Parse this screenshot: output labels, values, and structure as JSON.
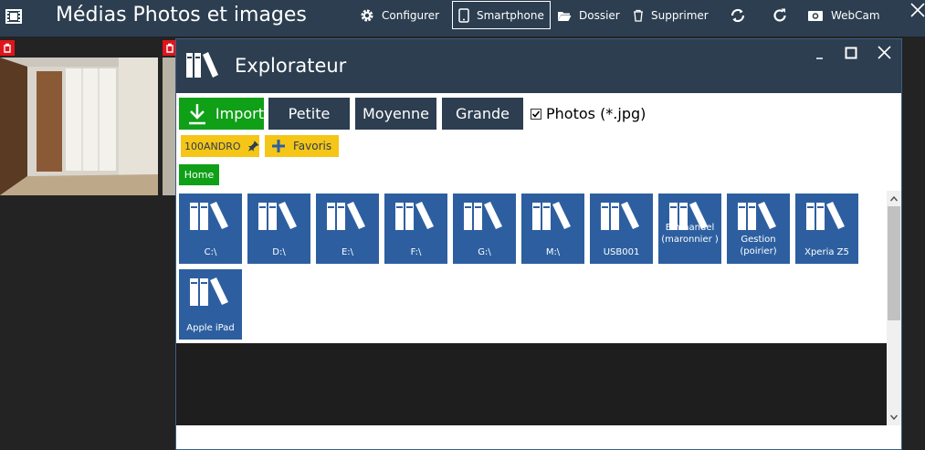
{
  "app": {
    "title": "Médias Photos et images"
  },
  "toolbar": {
    "configure": "Configurer",
    "smartphone": "Smartphone",
    "folder": "Dossier",
    "delete": "Supprimer",
    "webcam": "WebCam"
  },
  "explorer": {
    "title": "Explorateur",
    "import_label": "Import",
    "sizes": [
      "Petite",
      "Moyenne",
      "Grande"
    ],
    "filter_label": "Photos (*.jpg)",
    "filter_checked": true,
    "pinned_folder": "100ANDRO",
    "favorites_label": "Favoris",
    "home_label": "Home",
    "drives": [
      {
        "label": "C:\\"
      },
      {
        "label": "D:\\"
      },
      {
        "label": "E:\\"
      },
      {
        "label": "F:\\"
      },
      {
        "label": "G:\\"
      },
      {
        "label": "M:\\"
      },
      {
        "label": "USB001"
      },
      {
        "label": "Emmanuel (maronnier )"
      },
      {
        "label": "Gestion (poirier)"
      },
      {
        "label": "Xperia Z5"
      },
      {
        "label": "Apple iPad"
      }
    ]
  },
  "colors": {
    "header": "#2c3e50",
    "green": "#0fa017",
    "yellow": "#f5c518",
    "tile": "#2d5fa0",
    "delete_badge": "#e0141b"
  }
}
